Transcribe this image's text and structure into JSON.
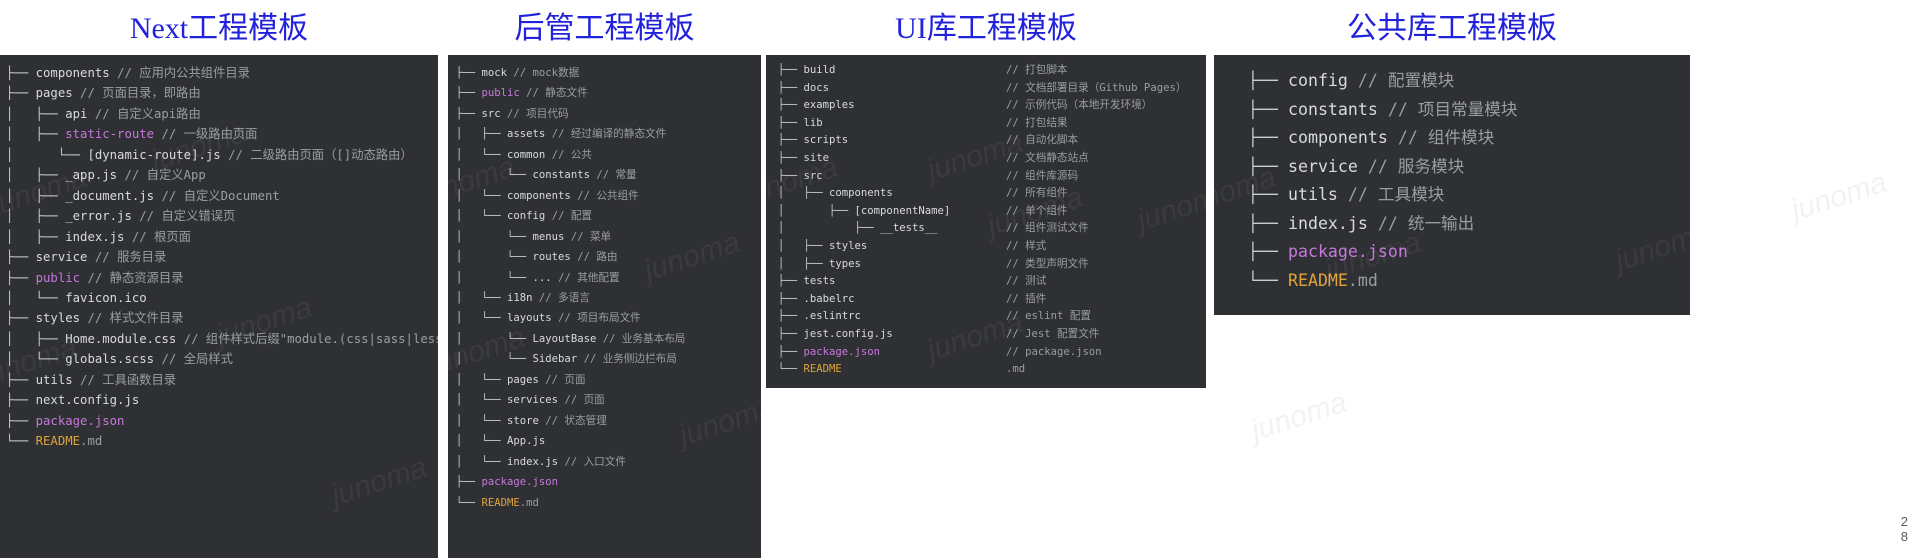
{
  "page": {
    "page_number_line1": "2",
    "page_number_line2": "8",
    "accent_title_color": "#2222dd",
    "panel_background": "#2f3033",
    "code_text_color": "#d8dade",
    "comment_text_color": "#9a9da3",
    "pink_color": "#c678dd",
    "orange_color": "#e0a33a",
    "watermark_text": "junoma"
  },
  "panels": [
    {
      "title": "Next工程模板",
      "rows": [
        {
          "prefix": "├── ",
          "name": "components",
          "color": "default",
          "comment": " // 应用内公共组件目录"
        },
        {
          "prefix": "├── ",
          "name": "pages",
          "color": "default",
          "comment": " // 页面目录，即路由"
        },
        {
          "prefix": "│   ├── ",
          "name": "api",
          "color": "default",
          "comment": " // 自定义api路由"
        },
        {
          "prefix": "│   ├── ",
          "name": "static-route",
          "color": "pink",
          "comment": " // 一级路由页面"
        },
        {
          "prefix": "│      └── ",
          "name": "[dynamic-route].js",
          "color": "default",
          "comment": " // 二级路由页面（[]动态路由）"
        },
        {
          "prefix": "│   ├── ",
          "name": "_app.js",
          "color": "default",
          "comment": " // 自定义App"
        },
        {
          "prefix": "│   ├── ",
          "name": "_document.js",
          "color": "default",
          "comment": " // 自定义Document"
        },
        {
          "prefix": "│   ├── ",
          "name": "_error.js",
          "color": "default",
          "comment": " // 自定义错误页"
        },
        {
          "prefix": "│   ├── ",
          "name": "index.js",
          "color": "default",
          "comment": " // 根页面"
        },
        {
          "prefix": "├── ",
          "name": "service",
          "color": "default",
          "comment": " // 服务目录"
        },
        {
          "prefix": "├── ",
          "name": "public",
          "color": "pink",
          "comment": " // 静态资源目录"
        },
        {
          "prefix": "│   └── ",
          "name": "favicon.ico",
          "color": "default",
          "comment": ""
        },
        {
          "prefix": "├── ",
          "name": "styles",
          "color": "default",
          "comment": " // 样式文件目录"
        },
        {
          "prefix": "│   ├── ",
          "name": "Home.module.css",
          "color": "default",
          "comment": " // 组件样式后缀\"module.(css|sass|less)\""
        },
        {
          "prefix": "│   └── ",
          "name": "globals.scss",
          "color": "default",
          "comment": " // 全局样式"
        },
        {
          "prefix": "├── ",
          "name": "utils",
          "color": "default",
          "comment": " // 工具函数目录"
        },
        {
          "prefix": "├── ",
          "name": "next.config.js",
          "color": "default",
          "comment": ""
        },
        {
          "prefix": "├── ",
          "name": "package.json",
          "color": "pink",
          "comment": ""
        },
        {
          "prefix": "└── ",
          "name": "README",
          "color": "orange",
          "comment": ".md"
        }
      ]
    },
    {
      "title": "后管工程模板",
      "rows": [
        {
          "prefix": "├── ",
          "name": "mock",
          "color": "default",
          "comment": " // mock数据"
        },
        {
          "prefix": "├── ",
          "name": "public",
          "color": "pink",
          "comment": " // 静态文件"
        },
        {
          "prefix": "├── ",
          "name": "src",
          "color": "default",
          "comment": " // 项目代码"
        },
        {
          "prefix": "│   ├── ",
          "name": "assets",
          "color": "default",
          "comment": " // 经过编译的静态文件"
        },
        {
          "prefix": "│   └── ",
          "name": "common",
          "color": "default",
          "comment": " // 公共"
        },
        {
          "prefix": "│       └── ",
          "name": "constants",
          "color": "default",
          "comment": " // 常量"
        },
        {
          "prefix": "│   └── ",
          "name": "components",
          "color": "default",
          "comment": " // 公共组件"
        },
        {
          "prefix": "│   └── ",
          "name": "config",
          "color": "default",
          "comment": " // 配置"
        },
        {
          "prefix": "│       └── ",
          "name": "menus",
          "color": "default",
          "comment": " // 菜单"
        },
        {
          "prefix": "│       └── ",
          "name": "routes",
          "color": "default",
          "comment": " // 路由"
        },
        {
          "prefix": "│       └── ",
          "name": "...",
          "color": "default",
          "comment": " // 其他配置"
        },
        {
          "prefix": "│   └── ",
          "name": "i18n",
          "color": "default",
          "comment": " // 多语言"
        },
        {
          "prefix": "│   └── ",
          "name": "layouts",
          "color": "default",
          "comment": " // 项目布局文件"
        },
        {
          "prefix": "│       └── ",
          "name": "LayoutBase",
          "color": "default",
          "comment": " // 业务基本布局"
        },
        {
          "prefix": "│       └── ",
          "name": "Sidebar",
          "color": "default",
          "comment": " // 业务侧边栏布局"
        },
        {
          "prefix": "│   └── ",
          "name": "pages",
          "color": "default",
          "comment": " // 页面"
        },
        {
          "prefix": "│   └── ",
          "name": "services",
          "color": "default",
          "comment": " // 页面"
        },
        {
          "prefix": "│   └── ",
          "name": "store",
          "color": "default",
          "comment": " // 状态管理"
        },
        {
          "prefix": "│   └── ",
          "name": "App.js",
          "color": "default",
          "comment": ""
        },
        {
          "prefix": "│   └── ",
          "name": "index.js",
          "color": "default",
          "comment": " // 入口文件"
        },
        {
          "prefix": "├── ",
          "name": "package.json",
          "color": "pink",
          "comment": ""
        },
        {
          "prefix": "└── ",
          "name": "README",
          "color": "orange",
          "comment": ".md"
        }
      ]
    },
    {
      "title": "UI库工程模板",
      "rows": [
        {
          "prefix": "├── ",
          "name": "build",
          "color": "default",
          "comment": "// 打包脚本"
        },
        {
          "prefix": "├── ",
          "name": "docs",
          "color": "default",
          "comment": "// 文档部署目录（Github Pages）"
        },
        {
          "prefix": "├── ",
          "name": "examples",
          "color": "default",
          "comment": "// 示例代码（本地开发环境）"
        },
        {
          "prefix": "├── ",
          "name": "lib",
          "color": "default",
          "comment": "// 打包结果"
        },
        {
          "prefix": "├── ",
          "name": "scripts",
          "color": "default",
          "comment": "// 自动化脚本"
        },
        {
          "prefix": "├── ",
          "name": "site",
          "color": "default",
          "comment": "// 文档静态站点"
        },
        {
          "prefix": "├── ",
          "name": "src",
          "color": "default",
          "comment": "// 组件库源码"
        },
        {
          "prefix": "│   ├── ",
          "name": "components",
          "color": "default",
          "comment": "// 所有组件"
        },
        {
          "prefix": "│       ├── ",
          "name": "[componentName]",
          "color": "default",
          "comment": "// 单个组件"
        },
        {
          "prefix": "│           ├── ",
          "name": "__tests__",
          "color": "default",
          "comment": "// 组件测试文件"
        },
        {
          "prefix": "│   ├── ",
          "name": "styles",
          "color": "default",
          "comment": "// 样式"
        },
        {
          "prefix": "│   ├── ",
          "name": "types",
          "color": "default",
          "comment": "// 类型声明文件"
        },
        {
          "prefix": "├── ",
          "name": "tests",
          "color": "default",
          "comment": "// 测试"
        },
        {
          "prefix": "├── ",
          "name": ".babelrc",
          "color": "default",
          "comment": "// 插件"
        },
        {
          "prefix": "├── ",
          "name": ".eslintrc",
          "color": "default",
          "comment": "// eslint 配置"
        },
        {
          "prefix": "├── ",
          "name": "jest.config.js",
          "color": "default",
          "comment": "// Jest 配置文件"
        },
        {
          "prefix": "├── ",
          "name": "package.json",
          "color": "pink",
          "comment": "// package.json"
        },
        {
          "prefix": "└── ",
          "name": "README",
          "color": "orange",
          "comment": ".md"
        }
      ]
    },
    {
      "title": "公共库工程模板",
      "rows": [
        {
          "prefix": "├── ",
          "name": "config",
          "color": "default",
          "comment": " // 配置模块"
        },
        {
          "prefix": "├── ",
          "name": "constants",
          "color": "default",
          "comment": " // 项目常量模块"
        },
        {
          "prefix": "├── ",
          "name": "components",
          "color": "default",
          "comment": " // 组件模块"
        },
        {
          "prefix": "├── ",
          "name": "service",
          "color": "default",
          "comment": " // 服务模块"
        },
        {
          "prefix": "├── ",
          "name": "utils",
          "color": "default",
          "comment": " // 工具模块"
        },
        {
          "prefix": "├── ",
          "name": "index.js",
          "color": "default",
          "comment": " // 统一输出"
        },
        {
          "prefix": "├── ",
          "name": "package.json",
          "color": "pink",
          "comment": ""
        },
        {
          "prefix": "└── ",
          "name": "README",
          "color": "orange",
          "comment": ".md"
        }
      ]
    }
  ]
}
